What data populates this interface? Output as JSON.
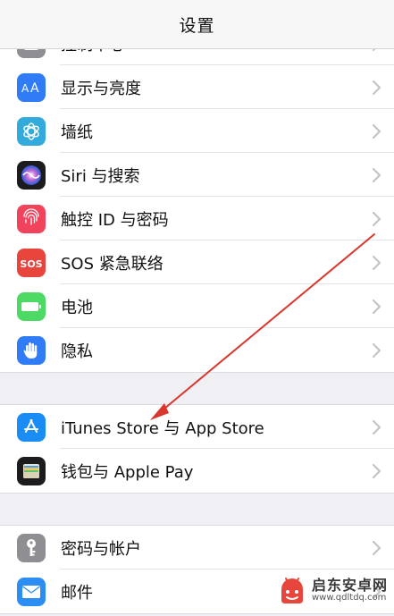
{
  "header": {
    "title": "设置"
  },
  "groups": [
    {
      "items": [
        {
          "label": "控制中心",
          "icon": "control-center-icon",
          "color": "#8e8e93"
        },
        {
          "label": "显示与亮度",
          "icon": "display-brightness-icon",
          "color": "#2f7cf6"
        },
        {
          "label": "墙纸",
          "icon": "wallpaper-icon",
          "color": "#33aadc"
        },
        {
          "label": "Siri 与搜索",
          "icon": "siri-icon",
          "color": "#1c1c1e"
        },
        {
          "label": "触控 ID 与密码",
          "icon": "touch-id-icon",
          "color": "#f2435c"
        },
        {
          "label": "SOS 紧急联络",
          "icon": "sos-icon",
          "color": "#e8463d"
        },
        {
          "label": "电池",
          "icon": "battery-icon",
          "color": "#4cd964"
        },
        {
          "label": "隐私",
          "icon": "privacy-hand-icon",
          "color": "#2f7cf6"
        }
      ]
    },
    {
      "items": [
        {
          "label": "iTunes Store 与 App Store",
          "icon": "app-store-icon",
          "color": "#1a8cf5"
        },
        {
          "label": "钱包与 Apple Pay",
          "icon": "wallet-icon",
          "color": "#1c1c1e"
        }
      ]
    },
    {
      "items": [
        {
          "label": "密码与帐户",
          "icon": "key-icon",
          "color": "#8e8e93"
        },
        {
          "label": "邮件",
          "icon": "mail-icon",
          "color": "#2c8ef5"
        }
      ]
    }
  ],
  "watermark": {
    "name": "启东安卓网",
    "url": "www.qdltdq.com",
    "icon": "watermark-logo-icon",
    "color": "#e8463d"
  },
  "annotation": {
    "color": "#d9372e"
  }
}
